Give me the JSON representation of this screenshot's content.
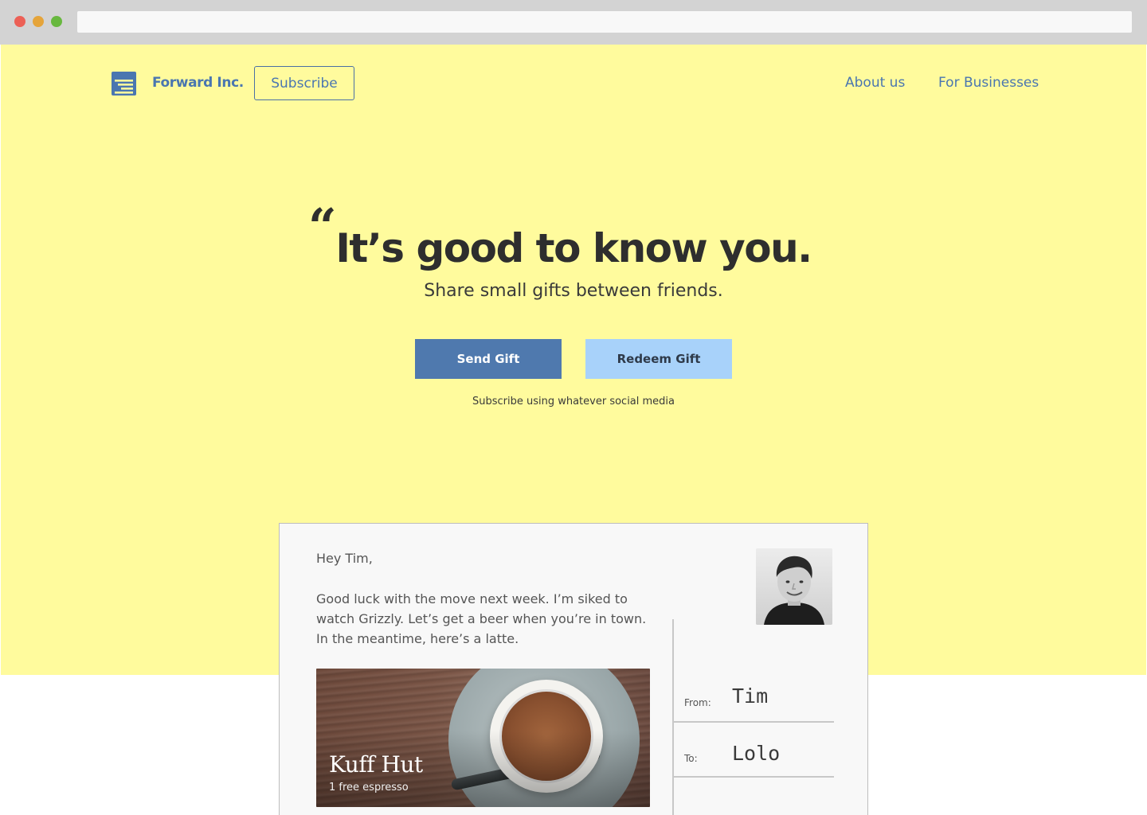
{
  "browser": {
    "controls": [
      "close",
      "minimize",
      "maximize"
    ],
    "url": ""
  },
  "nav": {
    "brand": "Forward Inc.",
    "logo_icon": "stacked-lines-logo-icon",
    "subscribe_label": "Subscribe",
    "links": [
      "About us",
      "For Businesses"
    ]
  },
  "hero": {
    "quote_mark": "“",
    "headline": "It’s good to know you.",
    "subheadline": "Share small gifts between friends.",
    "send_gift_label": "Send Gift",
    "redeem_gift_label": "Redeem Gift",
    "social_note": "Subscribe using whatever social media"
  },
  "card": {
    "greeting": "Hey Tim,",
    "message": "Good luck with the move next week. I’m siked to watch Grizzly. Let’s get a beer when you’re in town. In the meantime, here’s a latte.",
    "gift": {
      "title": "Kuff Hut",
      "subtitle": "1 free espresso"
    },
    "from_label": "From:",
    "from_name": "Tim",
    "to_label": "To:",
    "to_name": "Lolo"
  },
  "colors": {
    "hero_background": "#fffb9d",
    "brand_blue": "#4a76b0",
    "send_button": "#4f79ae",
    "redeem_button": "#a8d2fa",
    "headline_text": "#2e2e2e",
    "card_background": "#f8f8f8"
  }
}
